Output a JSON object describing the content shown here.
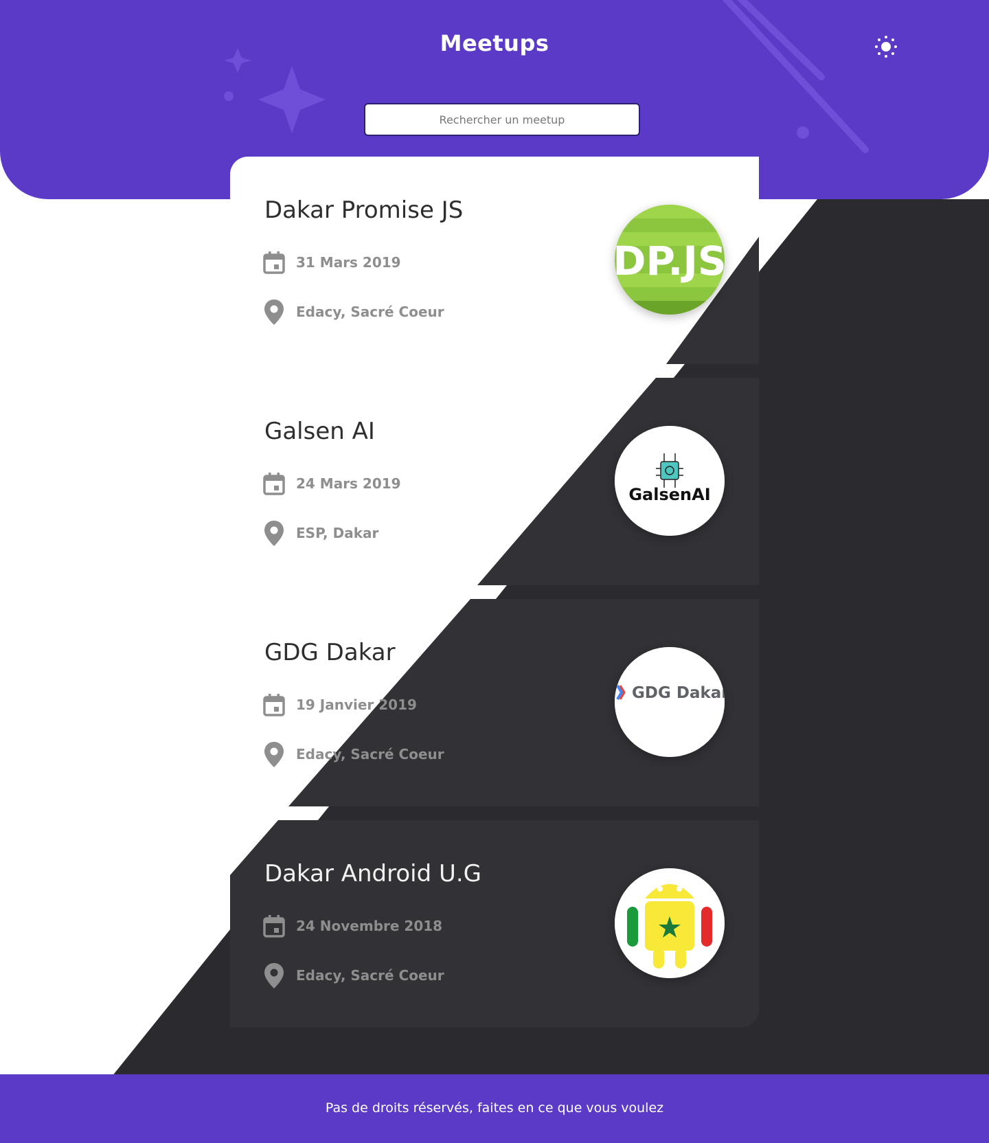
{
  "header": {
    "title": "Meetups",
    "theme_toggle_icon": "sun-icon",
    "search_placeholder": "Rechercher un meetup"
  },
  "meetups": [
    {
      "name": "Dakar Promise JS",
      "date": "31 Mars 2019",
      "location": "Edacy, Sacré Coeur",
      "logo": "dakar-promise-js-logo",
      "logo_text": "DP.JS"
    },
    {
      "name": "Galsen AI",
      "date": "24 Mars 2019",
      "location": "ESP, Dakar",
      "logo": "galsen-ai-logo",
      "logo_text": "GalsenAI"
    },
    {
      "name": "GDG Dakar",
      "date": "19 Janvier 2019",
      "location": "Edacy, Sacré Coeur",
      "logo": "gdg-dakar-logo",
      "logo_text": "GDG Dakar"
    },
    {
      "name": "Dakar Android U.G",
      "date": "24 Novembre 2018",
      "location": "Edacy, Sacré Coeur",
      "logo": "dakar-android-ug-logo",
      "logo_text": ""
    }
  ],
  "footer": {
    "text": "Pas de droits réservés, faites en ce que vous voulez"
  },
  "colors": {
    "primary": "#5b3ac8",
    "dark": "#2b2b2f",
    "card_dark": "#313136",
    "light": "#ffffff",
    "meta_text": "#8e8e8e"
  }
}
